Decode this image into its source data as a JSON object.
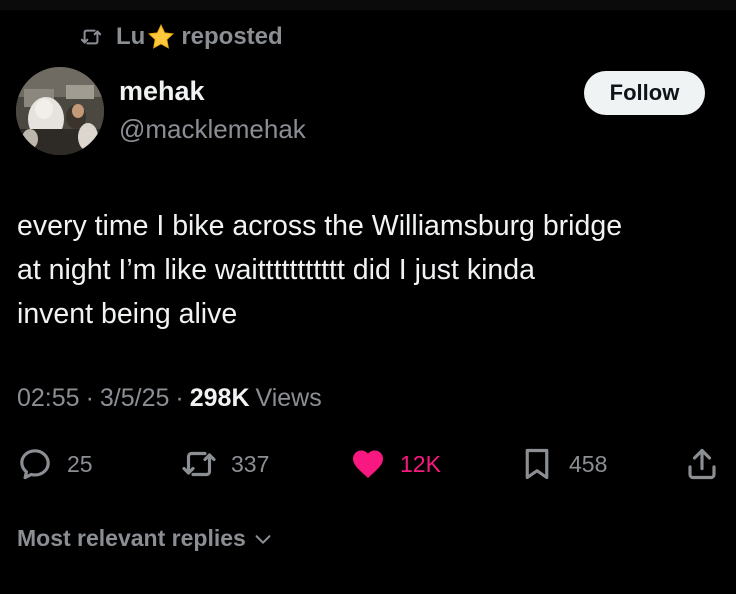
{
  "repost_banner": {
    "reposter": "Lu",
    "reposter_badge_icon": "star-emoji",
    "action": "reposted"
  },
  "author": {
    "display_name": "mehak",
    "handle": "@macklemehak"
  },
  "follow_button": {
    "label": "Follow"
  },
  "tweet": {
    "lines": [
      "every time I bike across the Williamsburg bridge",
      "at night I’m like waittttttttttt did I just kinda",
      "invent being alive"
    ]
  },
  "meta": {
    "time": "02:55",
    "separator": "·",
    "date": "3/5/25",
    "views_count": "298K",
    "views_label": "Views"
  },
  "actions": {
    "replies": "25",
    "reposts": "337",
    "likes": "12K",
    "bookmarks": "458"
  },
  "replies_sort": {
    "label": "Most relevant replies"
  },
  "colors": {
    "background": "#000000",
    "muted": "#8b8f94",
    "like": "#f91880",
    "text": "#f0f2f3"
  }
}
